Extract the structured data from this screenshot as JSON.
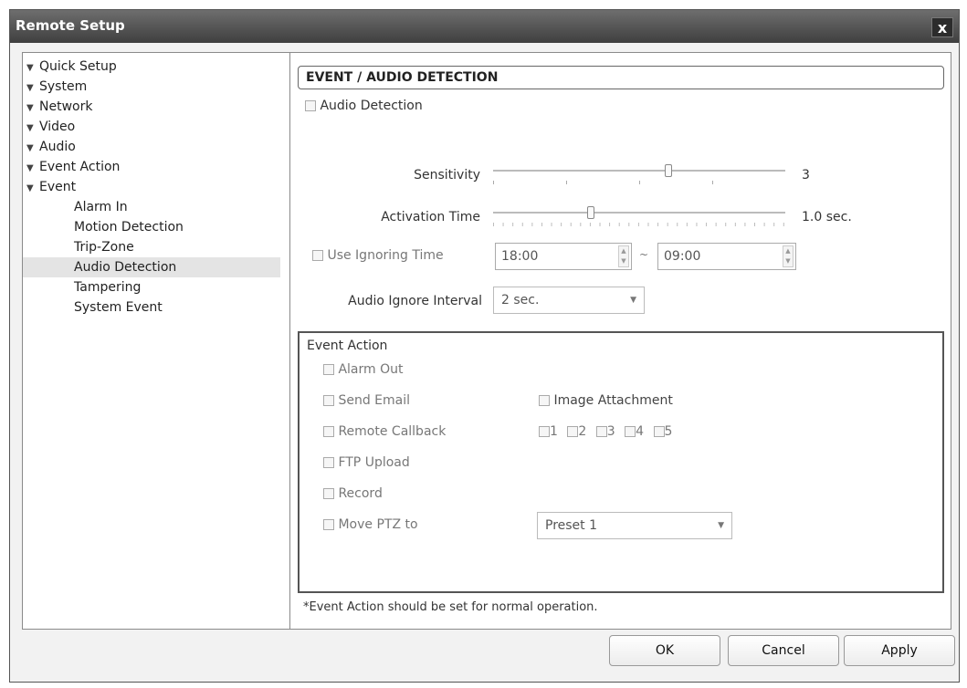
{
  "window": {
    "title": "Remote Setup",
    "close_glyph": "x"
  },
  "tree": {
    "top_items": [
      "Quick Setup",
      "System",
      "Network",
      "Video",
      "Audio",
      "Event Action",
      "Event"
    ],
    "sub_items": [
      "Alarm In",
      "Motion Detection",
      "Trip-Zone",
      "Audio Detection",
      "Tampering",
      "System Event"
    ],
    "selected": "Audio Detection"
  },
  "panel": {
    "title": "EVENT / AUDIO DETECTION",
    "enable_label": "Audio Detection",
    "sensitivity": {
      "label": "Sensitivity",
      "value": "3",
      "level": 3,
      "max": 5
    },
    "activation_time": {
      "label": "Activation Time",
      "value": "1.0 sec.",
      "level": 10,
      "max": 30
    },
    "ignoring_time": {
      "label": "Use Ignoring Time",
      "start": "18:00",
      "separator": "~",
      "end": "09:00"
    },
    "ignore_interval": {
      "label": "Audio Ignore Interval",
      "value": "2 sec."
    }
  },
  "event_action": {
    "legend": "Event Action",
    "alarm_out": "Alarm Out",
    "send_email": "Send Email",
    "image_attachment": "Image Attachment",
    "remote_callback": "Remote Callback",
    "callback_options": [
      "1",
      "2",
      "3",
      "4",
      "5"
    ],
    "ftp_upload": "FTP Upload",
    "record": "Record",
    "move_ptz": "Move PTZ to",
    "preset": "Preset 1"
  },
  "note": "*Event Action should be set for normal operation.",
  "buttons": {
    "ok": "OK",
    "cancel": "Cancel",
    "apply": "Apply"
  }
}
